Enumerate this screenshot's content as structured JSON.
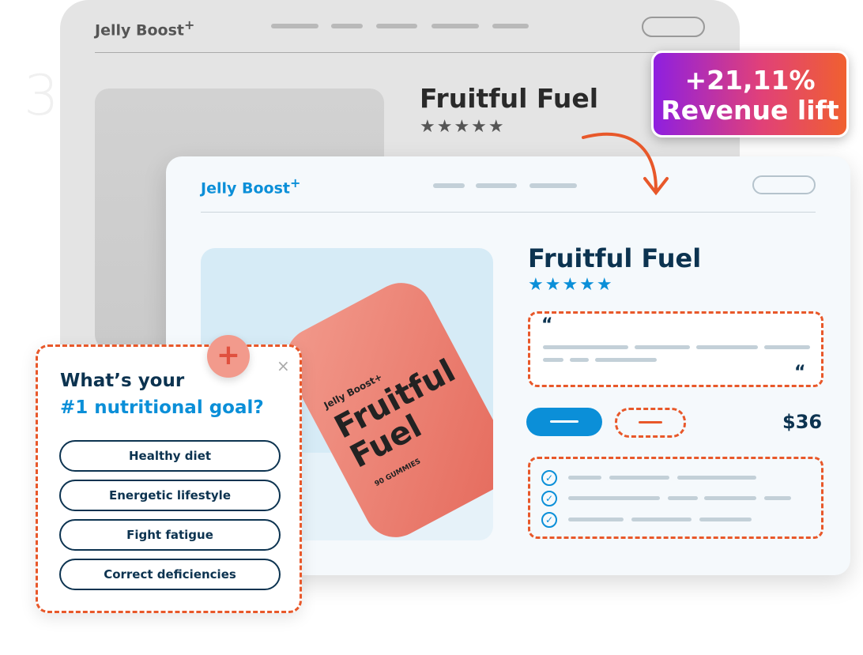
{
  "step_number": "3.",
  "before": {
    "brand": "Jelly Boost",
    "brand_sup": "+",
    "product_title": "Fruitful Fuel",
    "stars": "★★★★★"
  },
  "badge": {
    "line1": "+21,11%",
    "line2": "Revenue lift"
  },
  "after": {
    "brand": "Jelly Boost",
    "brand_sup": "+",
    "product_title": "Fruitful Fuel",
    "stars": "★★★★★",
    "quote_open": "“",
    "quote_close": "“",
    "price": "$36",
    "jar": {
      "brand": "Jelly Boost+",
      "name_line1": "Fruitful",
      "name_line2": "Fuel",
      "count": "90 GUMMIES"
    }
  },
  "popup": {
    "title_line1": "What’s your",
    "title_line2": "#1 nutritional goal?",
    "close": "×",
    "options": [
      "Healthy diet",
      "Energetic lifestyle",
      "Fight fatigue",
      "Correct deficiencies"
    ]
  },
  "colors": {
    "accent": "#0b8fd8",
    "navy": "#0c3350",
    "highlight": "#e8582a"
  }
}
